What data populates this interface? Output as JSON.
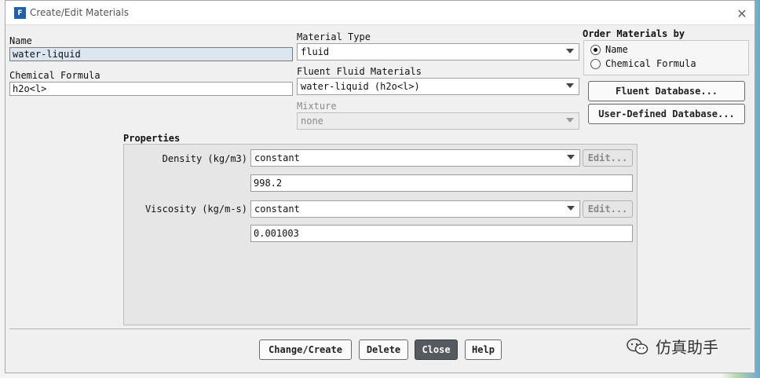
{
  "window": {
    "title": "Create/Edit Materials",
    "app_icon_letter": "F",
    "close_glyph": "✕"
  },
  "name": {
    "label": "Name",
    "value": "water-liquid"
  },
  "chemical_formula": {
    "label": "Chemical Formula",
    "value": "h2o<l>"
  },
  "material_type": {
    "label": "Material Type",
    "value": "fluid"
  },
  "fluent_fluid_materials": {
    "label": "Fluent Fluid Materials",
    "value": "water-liquid (h2o<l>)"
  },
  "mixture": {
    "label": "Mixture",
    "value": "none"
  },
  "order_by": {
    "label": "Order Materials by",
    "options": [
      {
        "label": "Name",
        "selected": true
      },
      {
        "label": "Chemical Formula",
        "selected": false
      }
    ]
  },
  "buttons_right": {
    "fluent_database": "Fluent Database...",
    "user_defined_database": "User-Defined Database..."
  },
  "properties": {
    "label": "Properties",
    "rows": [
      {
        "label": "Density (kg/m3)",
        "method": "constant",
        "edit": "Edit...",
        "value": "998.2"
      },
      {
        "label": "Viscosity (kg/m-s)",
        "method": "constant",
        "edit": "Edit...",
        "value": "0.001003"
      }
    ]
  },
  "footer": {
    "change_create": "Change/Create",
    "delete": "Delete",
    "close": "Close",
    "help": "Help"
  },
  "watermark": {
    "text": "仿真助手",
    "icon": "wechat-icon"
  }
}
